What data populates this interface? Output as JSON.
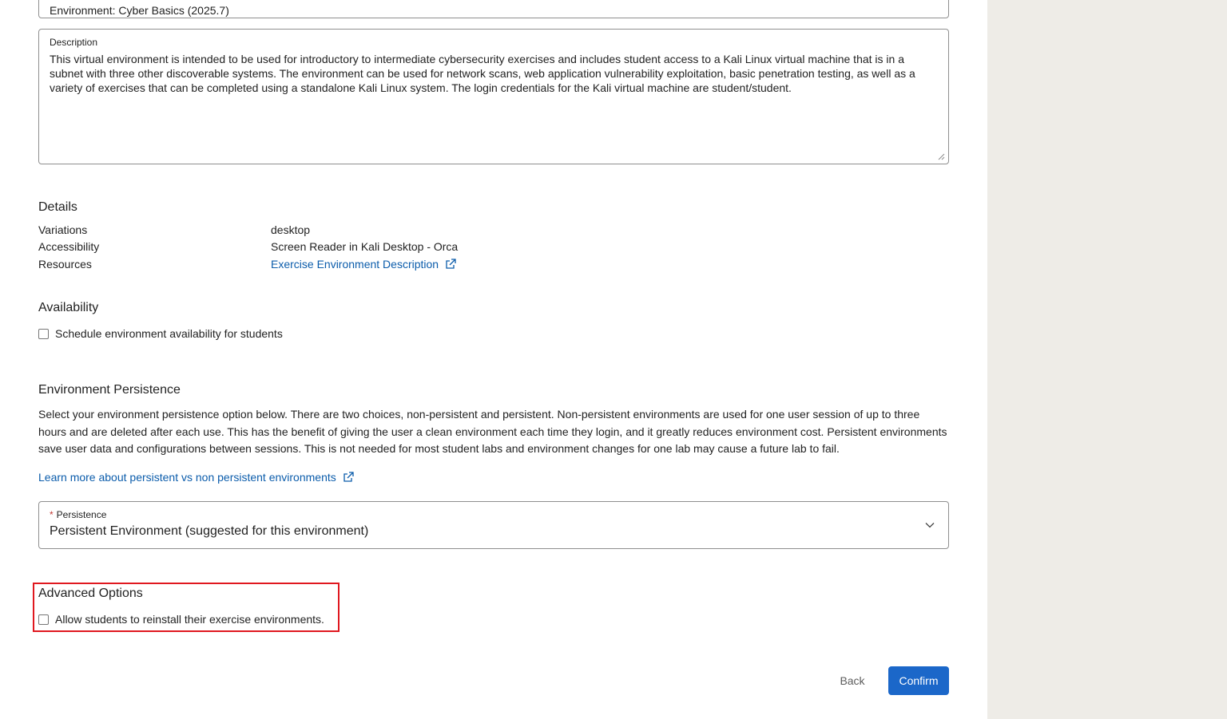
{
  "environment": {
    "text": "Environment: Cyber Basics (2025.7)"
  },
  "description": {
    "label": "Description",
    "value": "This virtual environment is intended to be used for introductory to intermediate cybersecurity exercises and includes student access to a Kali Linux virtual machine that is in a subnet with three other discoverable systems. The environment can be used for network scans, web application vulnerability exploitation, basic penetration testing, as well as a variety of exercises that can be completed using a standalone Kali Linux system. The login credentials for the Kali virtual machine are student/student."
  },
  "details": {
    "title": "Details",
    "rows": [
      {
        "label": "Variations",
        "value": "desktop"
      },
      {
        "label": "Accessibility",
        "value": "Screen Reader in Kali Desktop - Orca"
      },
      {
        "label": "Resources",
        "value": "Exercise Environment Description"
      }
    ]
  },
  "availability": {
    "title": "Availability",
    "checkbox_label": "Schedule environment availability for students",
    "checked": false
  },
  "persistence": {
    "title": "Environment Persistence",
    "paragraph": "Select your environment persistence option below. There are two choices, non-persistent and persistent. Non-persistent environments are used for one user session of up to three hours and are deleted after each use. This has the benefit of giving the user a clean environment each time they login, and it greatly reduces environment cost. Persistent environments save user data and configurations between sessions. This is not needed for most student labs and environment changes for one lab may cause a future lab to fail.",
    "learn_more": "Learn more about persistent vs non persistent environments",
    "select_label": "Persistence",
    "required_mark": "*",
    "selected": "Persistent Environment (suggested for this environment)"
  },
  "advanced": {
    "title": "Advanced Options",
    "checkbox_label": "Allow students to reinstall their exercise environments.",
    "checked": false
  },
  "actions": {
    "back": "Back",
    "confirm": "Confirm"
  },
  "colors": {
    "link": "#0b5cab",
    "primary_button": "#1b67c9",
    "highlight_border": "#e0181f",
    "sidebar_bg": "#eeece7",
    "required": "#c23934"
  }
}
